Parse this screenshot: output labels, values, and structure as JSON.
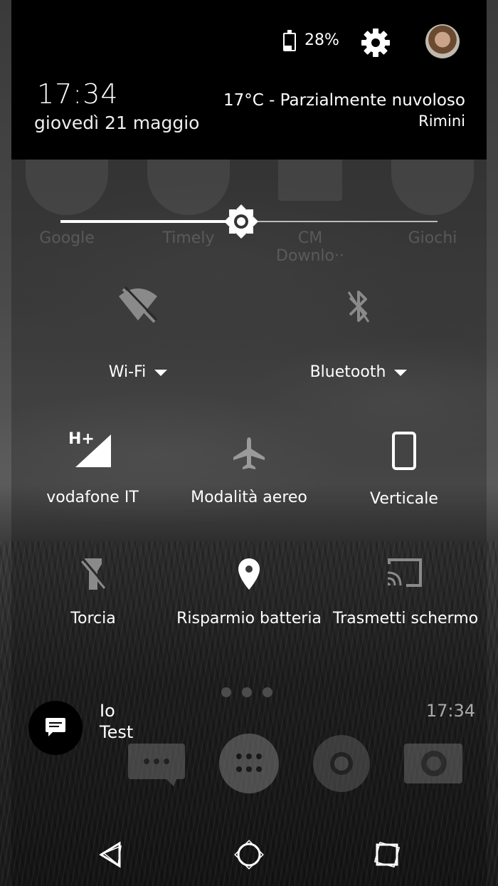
{
  "header": {
    "battery_percent": "28%",
    "battery_level": 0.28,
    "time": "17:34",
    "date": "giovedì 21 maggio",
    "weather": "17°C - Parzialmente nuvoloso",
    "city": "Rimini"
  },
  "brightness": {
    "level": 0.48
  },
  "background_apps": [
    {
      "label": "Google",
      "icon": "google-icon"
    },
    {
      "label": "Timely",
      "icon": "timely-icon"
    },
    {
      "label": "CM Downlo··",
      "icon": "cm-downloader-icon"
    },
    {
      "label": "Giochi",
      "icon": "games-folder-icon"
    }
  ],
  "tiles": {
    "wifi": {
      "label": "Wi-Fi",
      "icon": "wifi-off-icon"
    },
    "bluetooth": {
      "label": "Bluetooth",
      "icon": "bluetooth-off-icon"
    },
    "mobile": {
      "label": "vodafone IT",
      "icon": "cell-signal-icon",
      "network_type": "H+"
    },
    "airplane": {
      "label": "Modalità aereo",
      "icon": "airplane-icon"
    },
    "rotation": {
      "label": "Verticale",
      "icon": "portrait-icon"
    },
    "torch": {
      "label": "Torcia",
      "icon": "flashlight-off-icon"
    },
    "location": {
      "label": "Risparmio batteria",
      "icon": "location-icon"
    },
    "cast": {
      "label": "Trasmetti schermo",
      "icon": "cast-icon"
    }
  },
  "notification": {
    "title": "Io",
    "text": "Test",
    "time": "17:34",
    "icon": "message-icon"
  },
  "nav": {
    "back": "back-icon",
    "home": "home-icon",
    "recents": "recents-icon"
  },
  "colors": {
    "header_bg": "#000000",
    "text": "#ffffff",
    "dim_text": "#c8c8c8"
  }
}
